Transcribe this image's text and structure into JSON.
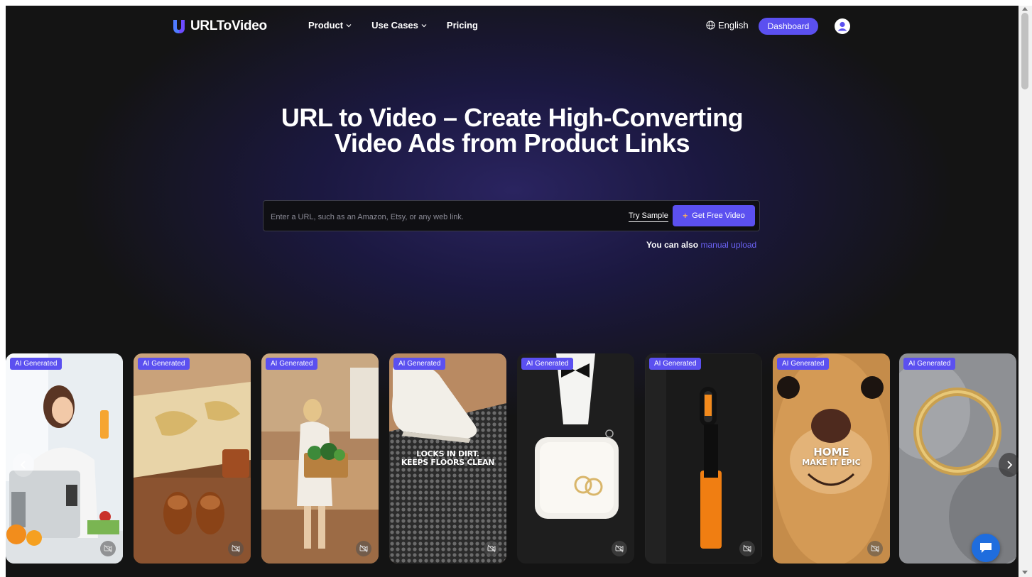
{
  "header": {
    "brand": "URLToVideo",
    "nav": [
      {
        "label": "Product"
      },
      {
        "label": "Use Cases"
      },
      {
        "label": "Pricing"
      }
    ],
    "language": "English",
    "dashboard_label": "Dashboard"
  },
  "hero": {
    "title_line1": "URL to Video – Create High-Converting",
    "title_line2": "Video Ads from Product Links"
  },
  "search": {
    "placeholder": "Enter a URL, such as an Amazon, Etsy, or any web link.",
    "try_sample": "Try Sample",
    "cta_label": "Get Free Video",
    "upload_prefix": "You can also",
    "upload_link": "manual upload"
  },
  "cards": {
    "badge": "AI Generated",
    "items": [
      {
        "caption": ""
      },
      {
        "caption": ""
      },
      {
        "caption": ""
      },
      {
        "caption_line1": "LOCKS IN DIRT.",
        "caption_line2": "KEEPS FLOORS CLEAN"
      },
      {
        "caption": ""
      },
      {
        "caption": ""
      },
      {
        "caption_line1": "HOME",
        "caption_line2": "MAKE IT EPIC"
      },
      {
        "caption": ""
      }
    ]
  },
  "icons": [
    "logo-icon",
    "chevron-down-icon",
    "globe-icon",
    "user-icon",
    "sparkle-icon",
    "mute-icon",
    "chevron-left-icon",
    "chevron-right-icon",
    "chat-icon"
  ],
  "colors": {
    "accent": "#5b50f0",
    "link": "#6b63f5",
    "background": "#141414",
    "chat": "#1f6dde"
  }
}
